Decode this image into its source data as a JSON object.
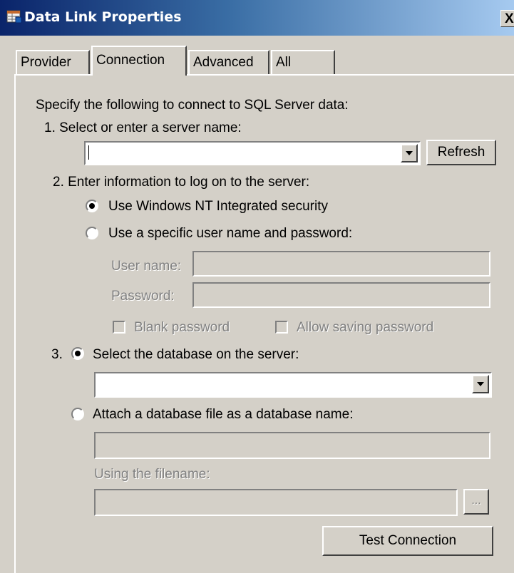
{
  "window": {
    "title": "Data Link Properties",
    "close_label": "X",
    "icon": "data-link-icon"
  },
  "tabs": [
    {
      "label": "Provider",
      "active": false
    },
    {
      "label": "Connection",
      "active": true
    },
    {
      "label": "Advanced",
      "active": false
    },
    {
      "label": "All",
      "active": false
    }
  ],
  "connection": {
    "intro": "Specify the following to connect to SQL Server data:",
    "step1": {
      "label": "1. Select or enter a server name:",
      "server_value": "",
      "refresh_label": "Refresh"
    },
    "step2": {
      "label": "2. Enter information to log on to the server:",
      "option_nt": "Use Windows NT Integrated security",
      "option_specific": "Use a specific user name and password:",
      "selected": "nt",
      "username_label": "User name:",
      "username_value": "",
      "password_label": "Password:",
      "password_value": "",
      "blank_password": "Blank password",
      "allow_saving": "Allow saving password"
    },
    "step3": {
      "number": "3.",
      "option_select_db": "Select the database on the server:",
      "database_value": "",
      "option_attach": "Attach a database file as a database name:",
      "attach_name_value": "",
      "filename_label": "Using the filename:",
      "filename_value": "",
      "browse_label": "...",
      "selected": "select_db"
    },
    "test_connection_label": "Test Connection"
  },
  "colors": {
    "face": "#d4d0c8",
    "title_start": "#0a246a",
    "title_end": "#a6caf0",
    "disabled_text": "#808080"
  }
}
